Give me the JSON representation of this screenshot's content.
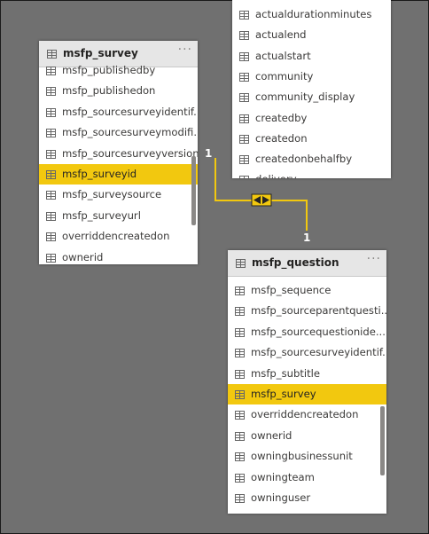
{
  "diagram": {
    "relationship": {
      "from_cardinality": "1",
      "to_cardinality": "1",
      "color": "#f2c80f",
      "direction": "both"
    },
    "tables": {
      "top_partial": {
        "fields": [
          "actualdurationminutes",
          "actualend",
          "actualstart",
          "community",
          "community_display",
          "createdby",
          "createdon",
          "createdonbehalfby",
          "delivery..."
        ]
      },
      "survey": {
        "title": "msfp_survey",
        "more": "···",
        "fields": [
          "msfp_publishedby",
          "msfp_publishedon",
          "msfp_sourcesurveyidentif...",
          "msfp_sourcesurveymodifi...",
          "msfp_sourcesurveyversion",
          "msfp_surveyid",
          "msfp_surveysource",
          "msfp_surveyurl",
          "overriddencreatedon",
          "ownerid"
        ],
        "selected_field": "msfp_surveyid"
      },
      "question": {
        "title": "msfp_question",
        "more": "···",
        "fields": [
          "msfp_sequence",
          "msfp_sourceparentquesti...",
          "msfp_sourcequestionide...",
          "msfp_sourcesurveyidentif...",
          "msfp_subtitle",
          "msfp_survey",
          "overriddencreatedon",
          "ownerid",
          "owningbusinessunit",
          "owningteam",
          "owninguser"
        ],
        "selected_field": "msfp_survey"
      }
    }
  },
  "colors": {
    "canvas": "#707070",
    "card": "#ffffff",
    "header": "#e6e6e6",
    "selected": "#f2c80f"
  }
}
